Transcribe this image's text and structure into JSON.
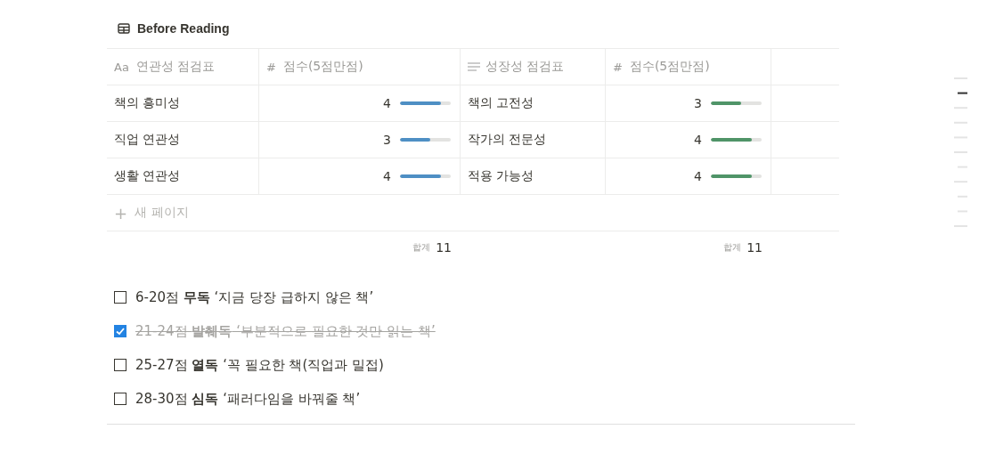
{
  "database": {
    "title": "Before Reading"
  },
  "columns": [
    {
      "icon": "Aa",
      "kind": "title",
      "label": "연관성 점검표"
    },
    {
      "icon": "#",
      "kind": "number",
      "label": "점수(5점만점)"
    },
    {
      "kind": "text",
      "label": "성장성 점검표"
    },
    {
      "icon": "#",
      "kind": "number",
      "label": "점수(5점만점)"
    }
  ],
  "rows": [
    {
      "item_a": "책의 흥미성",
      "score_a": {
        "value": "4",
        "level": 0.8
      },
      "item_b": "책의 고전성",
      "score_b": {
        "value": "3",
        "level": 0.6
      }
    },
    {
      "item_a": "직업 연관성",
      "score_a": {
        "value": "3",
        "level": 0.6
      },
      "item_b": "작가의 전문성",
      "score_b": {
        "value": "4",
        "level": 0.8
      }
    },
    {
      "item_a": "생활 연관성",
      "score_a": {
        "value": "4",
        "level": 0.8
      },
      "item_b": "적용 가능성",
      "score_b": {
        "value": "4",
        "level": 0.8
      }
    }
  ],
  "new_page": {
    "icon": "+",
    "label": "새 페이지"
  },
  "totals": [
    {
      "label": "합계",
      "value": "11"
    },
    {
      "label": "합계",
      "value": "11"
    }
  ],
  "checklist": [
    {
      "text": "6-20점 **무독** ‘지금 당장 급하지 않은 책’",
      "checked": false
    },
    {
      "text": "21-24점 **발췌독** ‘부분적으로 필요한 것만 읽는 책’",
      "checked": true
    },
    {
      "text": "25-27점 **열독** ‘꼭 필요한 책(직업과 밀접)",
      "checked": false
    },
    {
      "text": "28-30점 **심독** ‘패러다임을 바꿔줄 책’",
      "checked": false
    }
  ]
}
